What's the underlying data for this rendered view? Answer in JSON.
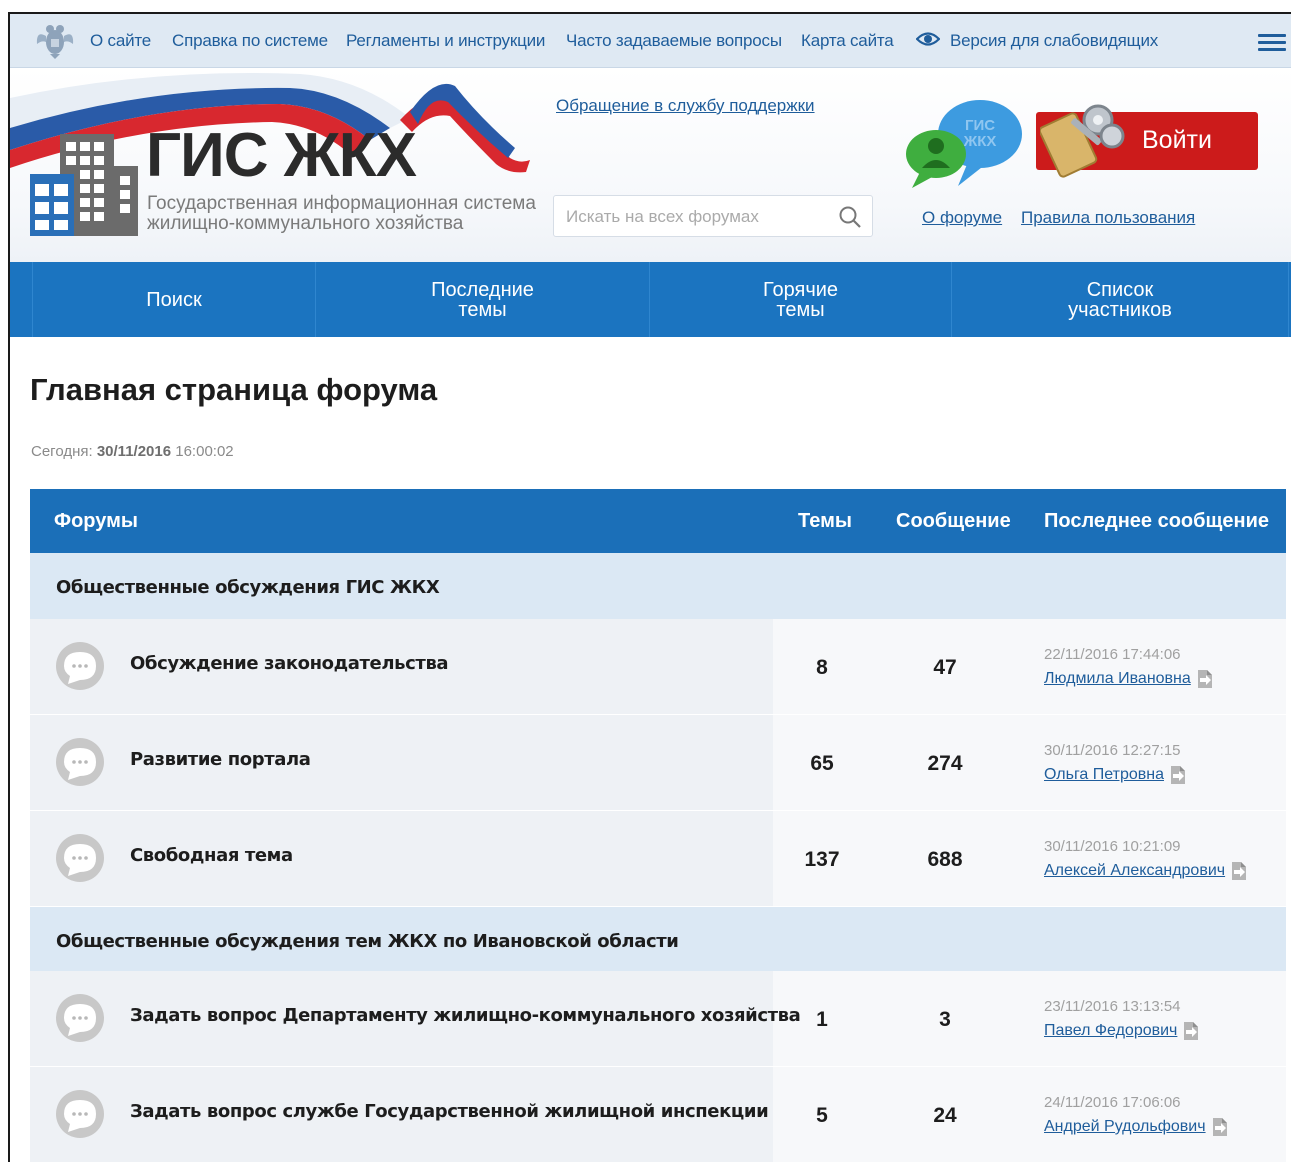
{
  "topbar": {
    "links": [
      "О сайте",
      "Справка по системе",
      "Регламенты и инструкции",
      "Часто задаваемые вопросы",
      "Карта сайта"
    ],
    "accessibility_label": "Версия для слабовидящих"
  },
  "header": {
    "brand": "ГИС ЖКХ",
    "brand_sub_line1": "Государственная информационная система",
    "brand_sub_line2": "жилищно-коммунального хозяйства",
    "support_link": "Обращение в службу поддержки",
    "search_placeholder": "Искать на всех форумах",
    "bubble_text_1": "ГИС",
    "bubble_text_2": "ЖКХ",
    "login_label": "Войти",
    "about_forum": "О форуме",
    "rules": "Правила пользования"
  },
  "nav": {
    "items": [
      "Поиск",
      "Последние\nтемы",
      "Горячие\nтемы",
      "Список\nучастников"
    ]
  },
  "main": {
    "title": "Главная страница форума",
    "today_label": "Сегодня:",
    "today_date": "30/11/2016",
    "today_time": "16:00:02"
  },
  "table": {
    "headers": {
      "forums": "Форумы",
      "topics": "Темы",
      "messages": "Сообщение",
      "last": "Последнее сообщение"
    },
    "categories": [
      {
        "title": "Общественные обсуждения ГИС ЖКХ",
        "forums": [
          {
            "title": "Обсуждение законодательства",
            "topics": "8",
            "messages": "47",
            "last_date": "22/11/2016 17:44:06",
            "last_user": "Людмила Ивановна"
          },
          {
            "title": "Развитие портала",
            "topics": "65",
            "messages": "274",
            "last_date": "30/11/2016 12:27:15",
            "last_user": "Ольга Петровна"
          },
          {
            "title": "Свободная тема",
            "topics": "137",
            "messages": "688",
            "last_date": "30/11/2016 10:21:09",
            "last_user": "Алексей Александрович"
          }
        ]
      },
      {
        "title": "Общественные обсуждения тем ЖКХ по Ивановской области",
        "forums": [
          {
            "title": "Задать вопрос Департаменту жилищно-коммунального хозяйства",
            "topics": "1",
            "messages": "3",
            "last_date": "23/11/2016 13:13:54",
            "last_user": "Павел Федорович"
          },
          {
            "title": "Задать вопрос службе Государственной жилищной инспекции",
            "topics": "5",
            "messages": "24",
            "last_date": "24/11/2016 17:06:06",
            "last_user": "Андрей Рудольфович"
          }
        ]
      }
    ]
  },
  "colors": {
    "nav_blue": "#1b74c0",
    "header_blue": "#1b6fb8",
    "category_bg": "#dbe8f4",
    "login_red": "#cc1b1b",
    "link_blue": "#1f5d9b"
  }
}
